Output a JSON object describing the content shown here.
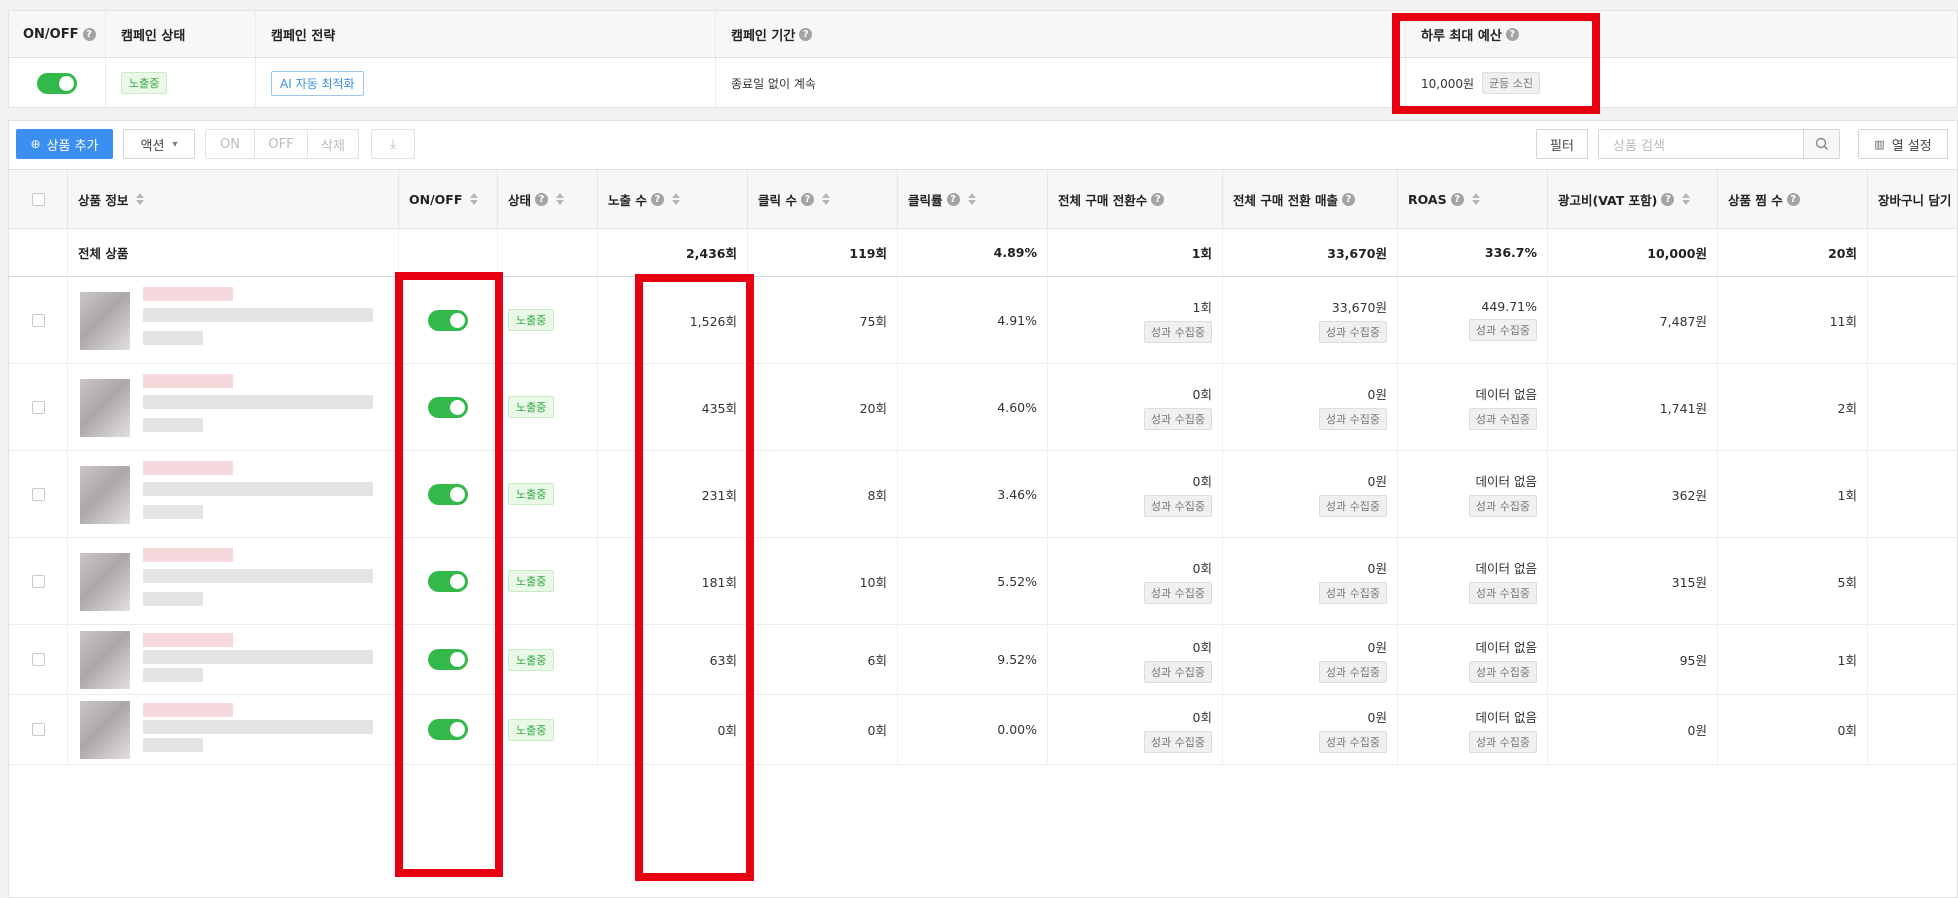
{
  "campaign": {
    "headers": {
      "onoff": "ON/OFF",
      "status": "캠페인 상태",
      "strategy": "캠페인 전략",
      "period": "캠페인 기간",
      "budget": "하루 최대 예산"
    },
    "help_glyph": "?",
    "status": "노출중",
    "strategy": "AI 자동 최적화",
    "period": "종료일 없이 계속",
    "budget": "10,000원",
    "budget_badge": "균등 소진"
  },
  "toolbar": {
    "add_product": "상품 추가",
    "action": "액션",
    "on": "ON",
    "off": "OFF",
    "delete": "삭제",
    "download_glyph": "⤓",
    "filter": "필터",
    "search_placeholder": "상품 검색",
    "column_settings": "열 설정"
  },
  "table": {
    "columns": {
      "product": "상품 정보",
      "onoff": "ON/OFF",
      "status": "상태",
      "impressions": "노출 수",
      "clicks": "클릭 수",
      "ctr": "클릭률",
      "conversions": "전체 구매 전환수",
      "revenue": "전체 구매 전환 매출",
      "roas": "ROAS",
      "ad_cost": "광고비(VAT 포함)",
      "favorites": "상품 찜 수",
      "cart": "장바구니 담기"
    },
    "total": {
      "label": "전체 상품",
      "impressions": "2,436회",
      "clicks": "119회",
      "ctr": "4.89%",
      "conversions": "1회",
      "revenue": "33,670원",
      "roas": "336.7%",
      "ad_cost": "10,000원",
      "favorites": "20회"
    },
    "collecting": "성과 수집중",
    "rows": [
      {
        "status": "노출중",
        "impressions": "1,526회",
        "clicks": "75회",
        "ctr": "4.91%",
        "conversions": "1회",
        "revenue": "33,670원",
        "roas": "449.71%",
        "ad_cost": "7,487원",
        "favorites": "11회"
      },
      {
        "status": "노출중",
        "impressions": "435회",
        "clicks": "20회",
        "ctr": "4.60%",
        "conversions": "0회",
        "revenue": "0원",
        "roas": "데이터 없음",
        "ad_cost": "1,741원",
        "favorites": "2회"
      },
      {
        "status": "노출중",
        "impressions": "231회",
        "clicks": "8회",
        "ctr": "3.46%",
        "conversions": "0회",
        "revenue": "0원",
        "roas": "데이터 없음",
        "ad_cost": "362원",
        "favorites": "1회"
      },
      {
        "status": "노출중",
        "impressions": "181회",
        "clicks": "10회",
        "ctr": "5.52%",
        "conversions": "0회",
        "revenue": "0원",
        "roas": "데이터 없음",
        "ad_cost": "315원",
        "favorites": "5회"
      },
      {
        "status": "노출중",
        "impressions": "63회",
        "clicks": "6회",
        "ctr": "9.52%",
        "conversions": "0회",
        "revenue": "0원",
        "roas": "데이터 없음",
        "ad_cost": "95원",
        "favorites": "1회"
      },
      {
        "status": "노출중",
        "impressions": "0회",
        "clicks": "0회",
        "ctr": "0.00%",
        "conversions": "0회",
        "revenue": "0원",
        "roas": "데이터 없음",
        "ad_cost": "0원",
        "favorites": "0회"
      }
    ]
  },
  "colors": {
    "toggle_on": "#33b94a",
    "primary": "#3a8ff0",
    "highlight": "#e60012"
  }
}
